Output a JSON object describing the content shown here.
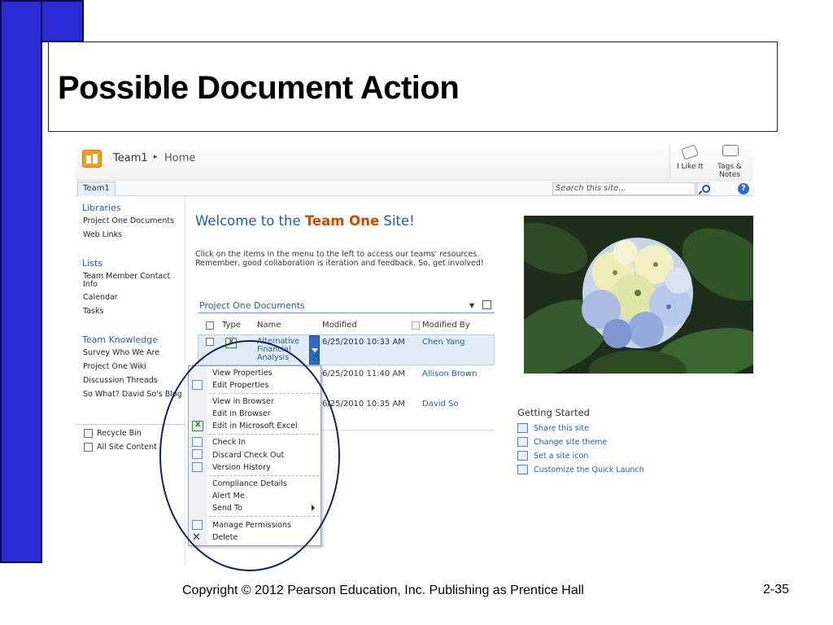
{
  "slide": {
    "title": "Possible Document Action",
    "copyright": "Copyright © 2012 Pearson Education, Inc. Publishing as Prentice Hall",
    "page_number": "2-35"
  },
  "site": {
    "breadcrumb_site": "Team1",
    "breadcrumb_sep": "▸",
    "breadcrumb_page": "Home",
    "like_label": "I Like It",
    "tags_label": "Tags & Notes",
    "tab_label": "Team1",
    "search_placeholder": "Search this site...",
    "help_glyph": "?"
  },
  "quick_launch": {
    "libraries_heading": "Libraries",
    "libraries": [
      "Project One Documents",
      "Web Links"
    ],
    "lists_heading": "Lists",
    "lists": [
      "Team Member Contact Info",
      "Calendar",
      "Tasks"
    ],
    "knowledge_heading": "Team Knowledge",
    "knowledge": [
      "Survey Who We Are",
      "Project One Wiki",
      "Discussion Threads",
      "So What? David So's Blog"
    ],
    "recycle_bin": "Recycle Bin",
    "all_site_content": "All Site Content"
  },
  "main": {
    "welcome_prefix": "Welcome to the ",
    "welcome_highlight": "Team One",
    "welcome_suffix": " Site!",
    "intro": "Click on the items in the menu to the left to access our teams' resources. Remember, good collaboration is iteration and feedback.  So, get involved!"
  },
  "doclib": {
    "title": "Project One Documents",
    "columns": [
      "Type",
      "Name",
      "Modified",
      "Modified By"
    ],
    "rows": [
      {
        "name": "Alternative Financial Analysis",
        "modified": "6/25/2010 10:33 AM",
        "modified_by": "Chen Yang"
      },
      {
        "name": "",
        "modified": "6/25/2010 11:40 AM",
        "modified_by": "Allison Brown"
      },
      {
        "name": "",
        "modified": "6/25/2010 10:35 AM",
        "modified_by": "David So"
      }
    ]
  },
  "context_menu": {
    "items": [
      "View Properties",
      "Edit Properties",
      "View in Browser",
      "Edit in Browser",
      "Edit in Microsoft Excel",
      "Check In",
      "Discard Check Out",
      "Version History",
      "Compliance Details",
      "Alert Me",
      "Send To",
      "Manage Permissions",
      "Delete"
    ]
  },
  "getting_started": {
    "title": "Getting Started",
    "items": [
      "Share this site",
      "Change site theme",
      "Set a site icon",
      "Customize the Quick Launch"
    ]
  }
}
